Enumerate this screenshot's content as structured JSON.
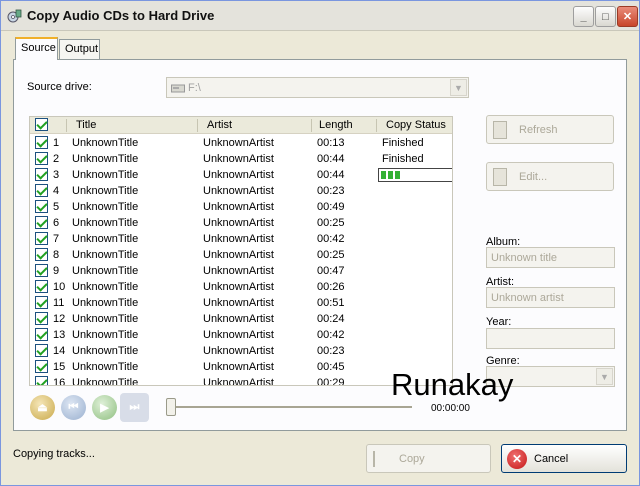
{
  "window": {
    "title": "Copy Audio CDs to Hard Drive",
    "minimize_glyph": "_",
    "maximize_glyph": "□",
    "close_glyph": "✕"
  },
  "tabs": [
    {
      "label": "Source",
      "active": true
    },
    {
      "label": "Output",
      "active": false
    }
  ],
  "source": {
    "label": "Source drive:",
    "value": "F:\\"
  },
  "columns": {
    "title": "Title",
    "artist": "Artist",
    "length": "Length",
    "status": "Copy Status"
  },
  "tracks": [
    {
      "num": "1",
      "title": "UnknownTitle",
      "artist": "UnknownArtist",
      "length": "00:13",
      "status": "Finished"
    },
    {
      "num": "2",
      "title": "UnknownTitle",
      "artist": "UnknownArtist",
      "length": "00:44",
      "status": "Finished"
    },
    {
      "num": "3",
      "title": "UnknownTitle",
      "artist": "UnknownArtist",
      "length": "00:44",
      "status": "",
      "progress": 0.3
    },
    {
      "num": "4",
      "title": "UnknownTitle",
      "artist": "UnknownArtist",
      "length": "00:23",
      "status": ""
    },
    {
      "num": "5",
      "title": "UnknownTitle",
      "artist": "UnknownArtist",
      "length": "00:49",
      "status": ""
    },
    {
      "num": "6",
      "title": "UnknownTitle",
      "artist": "UnknownArtist",
      "length": "00:25",
      "status": ""
    },
    {
      "num": "7",
      "title": "UnknownTitle",
      "artist": "UnknownArtist",
      "length": "00:42",
      "status": ""
    },
    {
      "num": "8",
      "title": "UnknownTitle",
      "artist": "UnknownArtist",
      "length": "00:25",
      "status": ""
    },
    {
      "num": "9",
      "title": "UnknownTitle",
      "artist": "UnknownArtist",
      "length": "00:47",
      "status": ""
    },
    {
      "num": "10",
      "title": "UnknownTitle",
      "artist": "UnknownArtist",
      "length": "00:26",
      "status": ""
    },
    {
      "num": "11",
      "title": "UnknownTitle",
      "artist": "UnknownArtist",
      "length": "00:51",
      "status": ""
    },
    {
      "num": "12",
      "title": "UnknownTitle",
      "artist": "UnknownArtist",
      "length": "00:24",
      "status": ""
    },
    {
      "num": "13",
      "title": "UnknownTitle",
      "artist": "UnknownArtist",
      "length": "00:42",
      "status": ""
    },
    {
      "num": "14",
      "title": "UnknownTitle",
      "artist": "UnknownArtist",
      "length": "00:23",
      "status": ""
    },
    {
      "num": "15",
      "title": "UnknownTitle",
      "artist": "UnknownArtist",
      "length": "00:45",
      "status": ""
    },
    {
      "num": "16",
      "title": "UnknownTitle",
      "artist": "UnknownArtist",
      "length": "00:29",
      "status": ""
    }
  ],
  "side_buttons": {
    "refresh": "Refresh",
    "edit": "Edit..."
  },
  "metadata": {
    "album_label": "Album:",
    "album_placeholder": "Unknown title",
    "artist_label": "Artist:",
    "artist_placeholder": "Unknown artist",
    "year_label": "Year:",
    "year_value": "",
    "genre_label": "Genre:",
    "genre_value": ""
  },
  "player": {
    "time": "00:00:00",
    "position": 0
  },
  "watermark": "Runakay",
  "footer": {
    "status": "Copying tracks...",
    "copy_label": "Copy",
    "cancel_label": "Cancel"
  },
  "icons": {
    "app": "cd-copy-icon",
    "drive": "cd-drive-icon",
    "refresh": "refresh-icon",
    "edit": "edit-icon",
    "eject": "eject-icon",
    "prev": "previous-track-icon",
    "play": "play-icon",
    "next": "next-track-icon",
    "copy": "copy-icon",
    "cancel": "cancel-icon"
  }
}
